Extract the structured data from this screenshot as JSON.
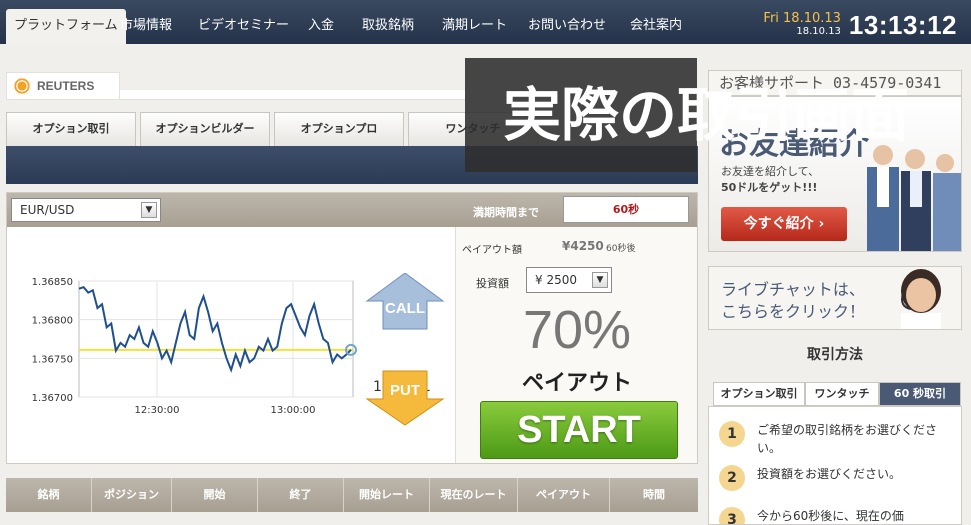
{
  "nav": {
    "items": [
      "プラットフォーム",
      "市場情報",
      "ビデオセミナー",
      "入金",
      "取扱銘柄",
      "満期レート",
      "お問い合わせ",
      "会社案内"
    ]
  },
  "clock": {
    "day": "Fri 18.10.13",
    "date": "18.10.13",
    "time": "13:13:12"
  },
  "logo": {
    "text": "REUTERS"
  },
  "tabs": [
    "オプション取引",
    "オプションビルダー",
    "オプションプロ",
    "ワンタッチ"
  ],
  "overlay": {
    "text": "実際の取引画面"
  },
  "panel": {
    "pair": "EUR/USD",
    "expire_label": "満期時間まで",
    "expire_value": "60秒"
  },
  "chart_data": {
    "type": "line",
    "x_ticks": [
      "12:30:00",
      "13:00:00"
    ],
    "y_ticks": [
      "1.36850",
      "1.36800",
      "1.36750",
      "1.36700"
    ],
    "ylim": [
      1.367,
      1.3685
    ],
    "strike": 1.36761,
    "values": [
      1.3684,
      1.36842,
      1.36835,
      1.36838,
      1.36815,
      1.3682,
      1.3679,
      1.36795,
      1.3676,
      1.3677,
      1.36765,
      1.3678,
      1.36775,
      1.3679,
      1.3677,
      1.36765,
      1.36785,
      1.3677,
      1.3675,
      1.3676,
      1.36745,
      1.3677,
      1.36795,
      1.3681,
      1.3678,
      1.36775,
      1.36815,
      1.3683,
      1.3681,
      1.36785,
      1.36795,
      1.3677,
      1.3675,
      1.36735,
      1.36755,
      1.3674,
      1.3676,
      1.36745,
      1.3675,
      1.36765,
      1.3676,
      1.36775,
      1.3676,
      1.36765,
      1.36795,
      1.36815,
      1.3682,
      1.36805,
      1.3679,
      1.3678,
      1.36805,
      1.3682,
      1.36795,
      1.36775,
      1.3677,
      1.36745,
      1.36755,
      1.3675,
      1.36755,
      1.36761
    ]
  },
  "trade": {
    "current_price": "1.36761",
    "call_label": "CALL",
    "put_label": "PUT",
    "payout_label": "ペイアウト額",
    "payout_amount": "¥4250",
    "payout_suffix": "60秒後",
    "invest_label": "投資額",
    "invest_value": "¥ 2500",
    "percent": "70%",
    "payout_text": "ペイアウト",
    "start_label": "START"
  },
  "table_headers": [
    "銘柄",
    "ポジション",
    "開始",
    "終了",
    "開始レート",
    "現在のレート",
    "ペイアウト",
    "時間"
  ],
  "sidebar": {
    "support": "お客様サポート 03-4579-0341",
    "promo_big": "お友達紹介",
    "promo_line1": "お友達を紹介して、",
    "promo_line2": "50ドルをゲット!!!",
    "promo_button": "今すぐ紹介 ›",
    "chat_line1": "ライブチャットは、",
    "chat_line2": "こちらをクリック！",
    "howto_title": "取引方法",
    "howto_tabs": [
      "オプション取引",
      "ワンタッチ",
      "60 秒取引"
    ],
    "steps": [
      {
        "num": "1",
        "text": "ご希望の取引銘柄をお選びください。"
      },
      {
        "num": "2",
        "text": "投資額をお選びください。"
      },
      {
        "num": "3",
        "text": "今から60秒後に、現在の価"
      }
    ]
  },
  "colors": {
    "nav_bg": "#2c3b55",
    "accent_gold": "#f5c24a",
    "start_green": "#5aa81e",
    "expire_red": "#b01c1c"
  }
}
